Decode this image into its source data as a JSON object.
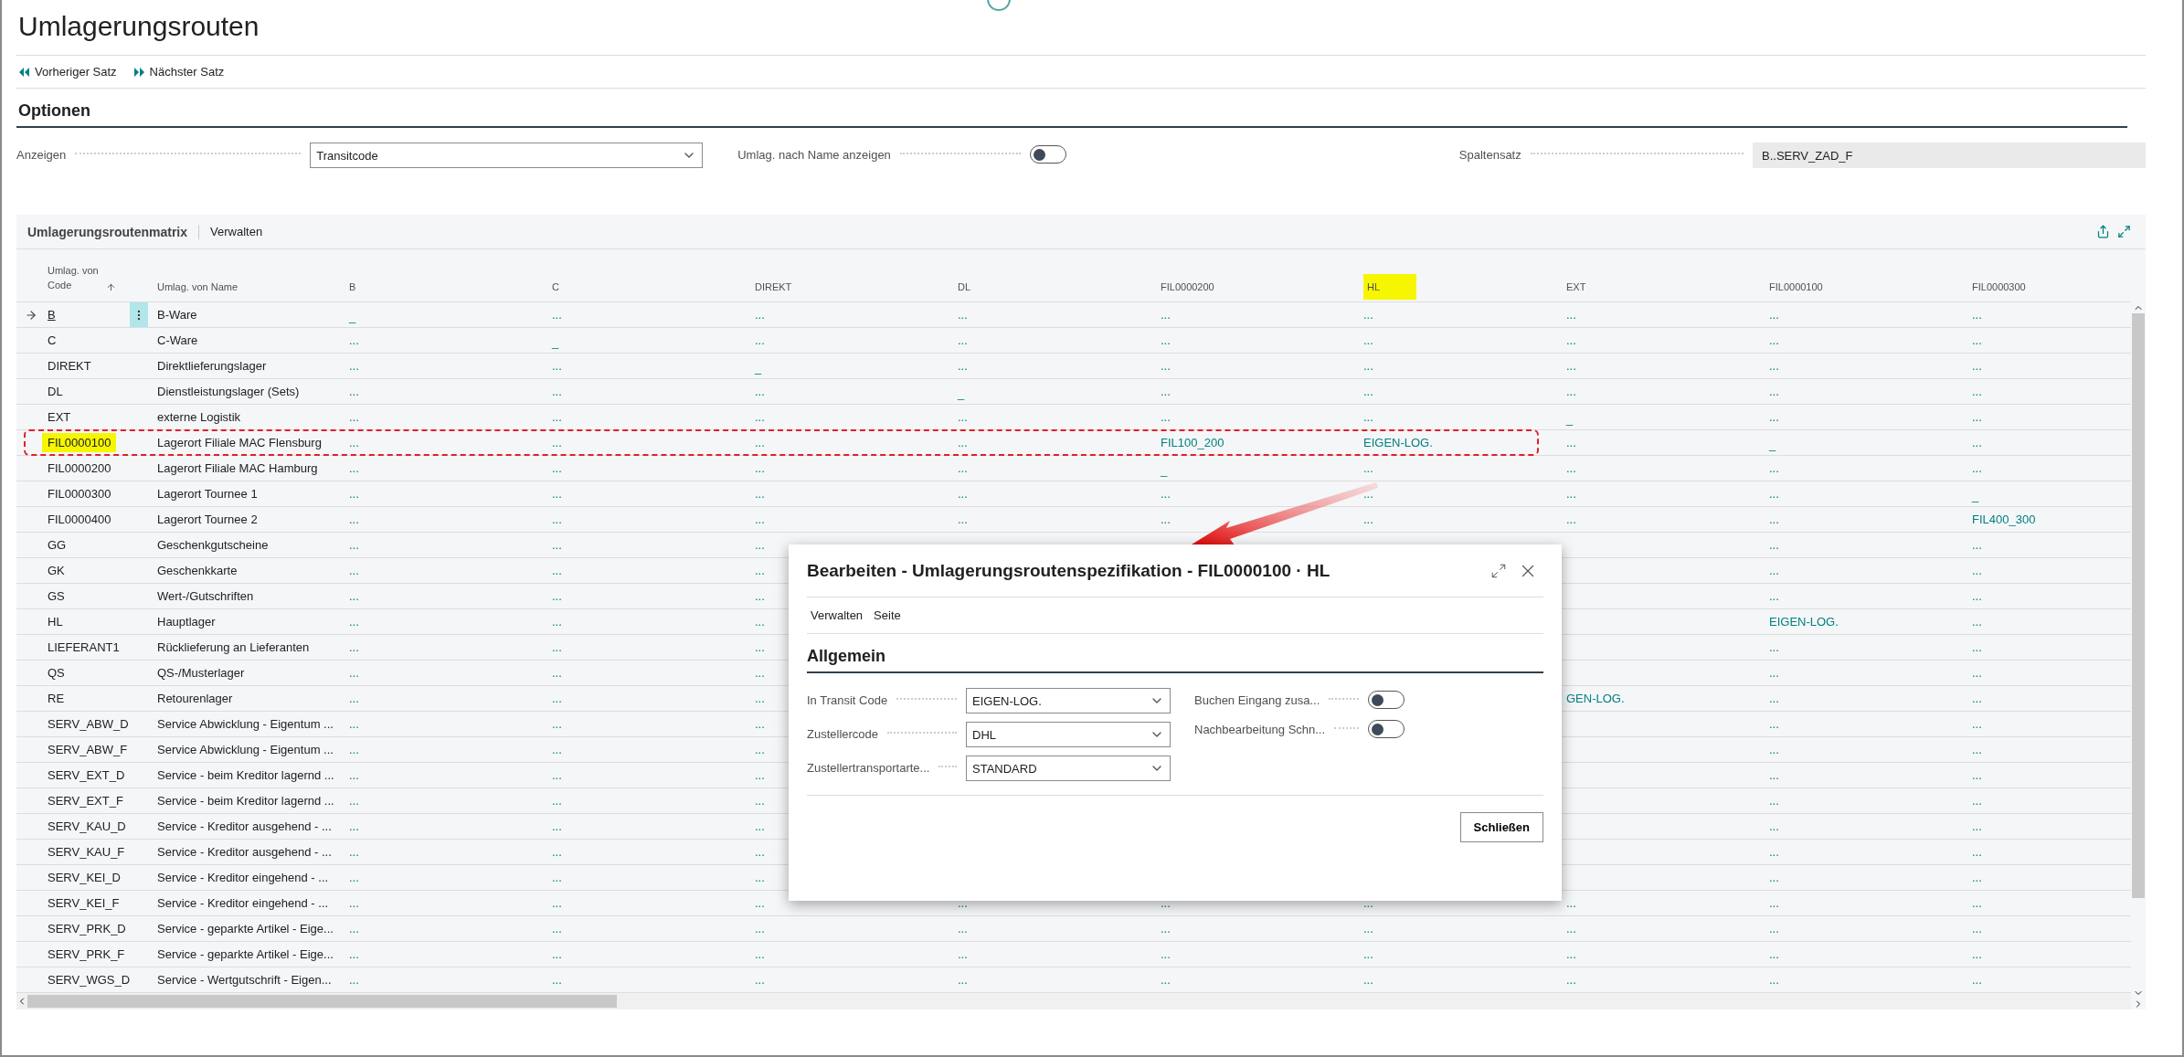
{
  "page": {
    "title": "Umlagerungsrouten"
  },
  "actions": [
    {
      "label": "Vorheriger Satz",
      "kind": "prev"
    },
    {
      "label": "Nächster Satz",
      "kind": "next"
    }
  ],
  "options": {
    "title": "Optionen",
    "fields": [
      {
        "kind": "select",
        "label": "Anzeigen",
        "value": "Transitcode"
      },
      {
        "kind": "toggle",
        "label": "Umlag. nach Name anzeigen",
        "on": false
      },
      {
        "kind": "readonly",
        "label": "Spaltensatz",
        "value": "B..SERV_ZAD_F"
      }
    ]
  },
  "matrix": {
    "title": "Umlagerungsroutenmatrix",
    "menu": [
      "Verwalten"
    ],
    "code_header": "Umlag. von Code",
    "name_header": "Umlag. von Name",
    "columns": [
      {
        "label": "B",
        "highlighted": false
      },
      {
        "label": "C",
        "highlighted": false
      },
      {
        "label": "DIREKT",
        "highlighted": false
      },
      {
        "label": "DL",
        "highlighted": false
      },
      {
        "label": "FIL0000200",
        "highlighted": false
      },
      {
        "label": "HL",
        "highlighted": true
      },
      {
        "label": "EXT",
        "highlighted": false
      },
      {
        "label": "FIL0000100",
        "highlighted": false
      },
      {
        "label": "FIL0000300",
        "highlighted": false
      }
    ],
    "rows": [
      {
        "code": "B",
        "name": "B-Ware",
        "selected": true,
        "highlighted": false,
        "annotated": false,
        "cells": [
          "_",
          "...",
          "...",
          "...",
          "...",
          "...",
          "...",
          "...",
          "..."
        ]
      },
      {
        "code": "C",
        "name": "C-Ware",
        "selected": false,
        "highlighted": false,
        "annotated": false,
        "cells": [
          "...",
          "_",
          "...",
          "...",
          "...",
          "...",
          "...",
          "...",
          "..."
        ]
      },
      {
        "code": "DIREKT",
        "name": "Direktlieferungslager",
        "selected": false,
        "highlighted": false,
        "annotated": false,
        "cells": [
          "...",
          "...",
          "_",
          "...",
          "...",
          "...",
          "...",
          "...",
          "..."
        ]
      },
      {
        "code": "DL",
        "name": "Dienstleistungslager (Sets)",
        "selected": false,
        "highlighted": false,
        "annotated": false,
        "cells": [
          "...",
          "...",
          "...",
          "_",
          "...",
          "...",
          "...",
          "...",
          "..."
        ]
      },
      {
        "code": "EXT",
        "name": "externe Logistik",
        "selected": false,
        "highlighted": false,
        "annotated": false,
        "cells": [
          "...",
          "...",
          "...",
          "...",
          "...",
          "...",
          "_",
          "...",
          "..."
        ]
      },
      {
        "code": "FIL0000100",
        "name": "Lagerort Filiale MAC Flensburg",
        "selected": false,
        "highlighted": true,
        "annotated": true,
        "cells": [
          "...",
          "...",
          "...",
          "...",
          "FIL100_200",
          "EIGEN-LOG.",
          "...",
          "_",
          "..."
        ]
      },
      {
        "code": "FIL0000200",
        "name": "Lagerort Filiale MAC Hamburg",
        "selected": false,
        "highlighted": false,
        "annotated": false,
        "cells": [
          "...",
          "...",
          "...",
          "...",
          "_",
          "...",
          "...",
          "...",
          "..."
        ]
      },
      {
        "code": "FIL0000300",
        "name": "Lagerort Tournee 1",
        "selected": false,
        "highlighted": false,
        "annotated": false,
        "cells": [
          "...",
          "...",
          "...",
          "...",
          "...",
          "...",
          "...",
          "...",
          "_"
        ]
      },
      {
        "code": "FIL0000400",
        "name": "Lagerort Tournee 2",
        "selected": false,
        "highlighted": false,
        "annotated": false,
        "cells": [
          "...",
          "...",
          "...",
          "...",
          "...",
          "...",
          "...",
          "...",
          "FIL400_300"
        ]
      },
      {
        "code": "GG",
        "name": "Geschenkgutscheine",
        "selected": false,
        "highlighted": false,
        "annotated": false,
        "cells": [
          "...",
          "...",
          "...",
          null,
          null,
          null,
          null,
          "...",
          "..."
        ]
      },
      {
        "code": "GK",
        "name": "Geschenkkarte",
        "selected": false,
        "highlighted": false,
        "annotated": false,
        "cells": [
          "...",
          "...",
          "...",
          null,
          null,
          null,
          null,
          "...",
          "..."
        ]
      },
      {
        "code": "GS",
        "name": "Wert-/Gutschriften",
        "selected": false,
        "highlighted": false,
        "annotated": false,
        "cells": [
          "...",
          "...",
          "...",
          null,
          null,
          null,
          null,
          "...",
          "..."
        ]
      },
      {
        "code": "HL",
        "name": "Hauptlager",
        "selected": false,
        "highlighted": false,
        "annotated": false,
        "cells": [
          "...",
          "...",
          "...",
          null,
          null,
          null,
          null,
          "EIGEN-LOG.",
          "..."
        ]
      },
      {
        "code": "LIEFERANT1",
        "name": "Rücklieferung an Lieferanten",
        "selected": false,
        "highlighted": false,
        "annotated": false,
        "cells": [
          "...",
          "...",
          "...",
          null,
          null,
          null,
          null,
          "...",
          "..."
        ]
      },
      {
        "code": "QS",
        "name": "QS-/Musterlager",
        "selected": false,
        "highlighted": false,
        "annotated": false,
        "cells": [
          "...",
          "...",
          "...",
          null,
          null,
          null,
          null,
          "...",
          "..."
        ]
      },
      {
        "code": "RE",
        "name": "Retourenlager",
        "selected": false,
        "highlighted": false,
        "annotated": false,
        "cells": [
          "...",
          "...",
          "...",
          null,
          null,
          null,
          "GEN-LOG.",
          "...",
          "..."
        ]
      },
      {
        "code": "SERV_ABW_D",
        "name": "Service Abwicklung - Eigentum ...",
        "selected": false,
        "highlighted": false,
        "annotated": false,
        "cells": [
          "...",
          "...",
          "...",
          null,
          null,
          null,
          null,
          "...",
          "..."
        ]
      },
      {
        "code": "SERV_ABW_F",
        "name": "Service Abwicklung - Eigentum ...",
        "selected": false,
        "highlighted": false,
        "annotated": false,
        "cells": [
          "...",
          "...",
          "...",
          null,
          null,
          null,
          null,
          "...",
          "..."
        ]
      },
      {
        "code": "SERV_EXT_D",
        "name": "Service - beim Kreditor lagernd ...",
        "selected": false,
        "highlighted": false,
        "annotated": false,
        "cells": [
          "...",
          "...",
          "...",
          null,
          null,
          null,
          null,
          "...",
          "..."
        ]
      },
      {
        "code": "SERV_EXT_F",
        "name": "Service - beim Kreditor lagernd ...",
        "selected": false,
        "highlighted": false,
        "annotated": false,
        "cells": [
          "...",
          "...",
          "...",
          null,
          null,
          null,
          null,
          "...",
          "..."
        ]
      },
      {
        "code": "SERV_KAU_D",
        "name": "Service - Kreditor ausgehend - ...",
        "selected": false,
        "highlighted": false,
        "annotated": false,
        "cells": [
          "...",
          "...",
          "...",
          null,
          null,
          null,
          null,
          "...",
          "..."
        ]
      },
      {
        "code": "SERV_KAU_F",
        "name": "Service - Kreditor ausgehend - ...",
        "selected": false,
        "highlighted": false,
        "annotated": false,
        "cells": [
          "...",
          "...",
          "...",
          null,
          null,
          null,
          null,
          "...",
          "..."
        ]
      },
      {
        "code": "SERV_KEI_D",
        "name": "Service - Kreditor eingehend - ...",
        "selected": false,
        "highlighted": false,
        "annotated": false,
        "cells": [
          "...",
          "...",
          "...",
          null,
          null,
          null,
          null,
          "...",
          "..."
        ]
      },
      {
        "code": "SERV_KEI_F",
        "name": "Service - Kreditor eingehend - ...",
        "selected": false,
        "highlighted": false,
        "annotated": false,
        "cells": [
          "...",
          "...",
          "...",
          "...",
          "...",
          "...",
          "...",
          "...",
          "..."
        ]
      },
      {
        "code": "SERV_PRK_D",
        "name": "Service - geparkte Artikel - Eige...",
        "selected": false,
        "highlighted": false,
        "annotated": false,
        "cells": [
          "...",
          "...",
          "...",
          "...",
          "...",
          "...",
          "...",
          "...",
          "..."
        ]
      },
      {
        "code": "SERV_PRK_F",
        "name": "Service - geparkte Artikel - Eige...",
        "selected": false,
        "highlighted": false,
        "annotated": false,
        "cells": [
          "...",
          "...",
          "...",
          "...",
          "...",
          "...",
          "...",
          "...",
          "..."
        ]
      },
      {
        "code": "SERV_WGS_D",
        "name": "Service - Wertgutschrift - Eigen...",
        "selected": false,
        "highlighted": false,
        "annotated": false,
        "cells": [
          "...",
          "...",
          "...",
          "...",
          "...",
          "...",
          "...",
          "...",
          "..."
        ]
      }
    ]
  },
  "dialog": {
    "title": "Bearbeiten - Umlagerungsroutenspezifikation - FIL0000100 · HL",
    "menu": [
      "Verwalten",
      "Seite"
    ],
    "section": "Allgemein",
    "left_fields": [
      {
        "label": "In Transit Code",
        "value": "EIGEN-LOG."
      },
      {
        "label": "Zustellercode",
        "value": "DHL"
      },
      {
        "label": "Zustellertransportarte...",
        "value": "STANDARD"
      }
    ],
    "right_fields": [
      {
        "label": "Buchen Eingang zusa...",
        "on": false
      },
      {
        "label": "Nachbearbeitung Schn...",
        "on": false
      }
    ],
    "button": "Schließen"
  }
}
